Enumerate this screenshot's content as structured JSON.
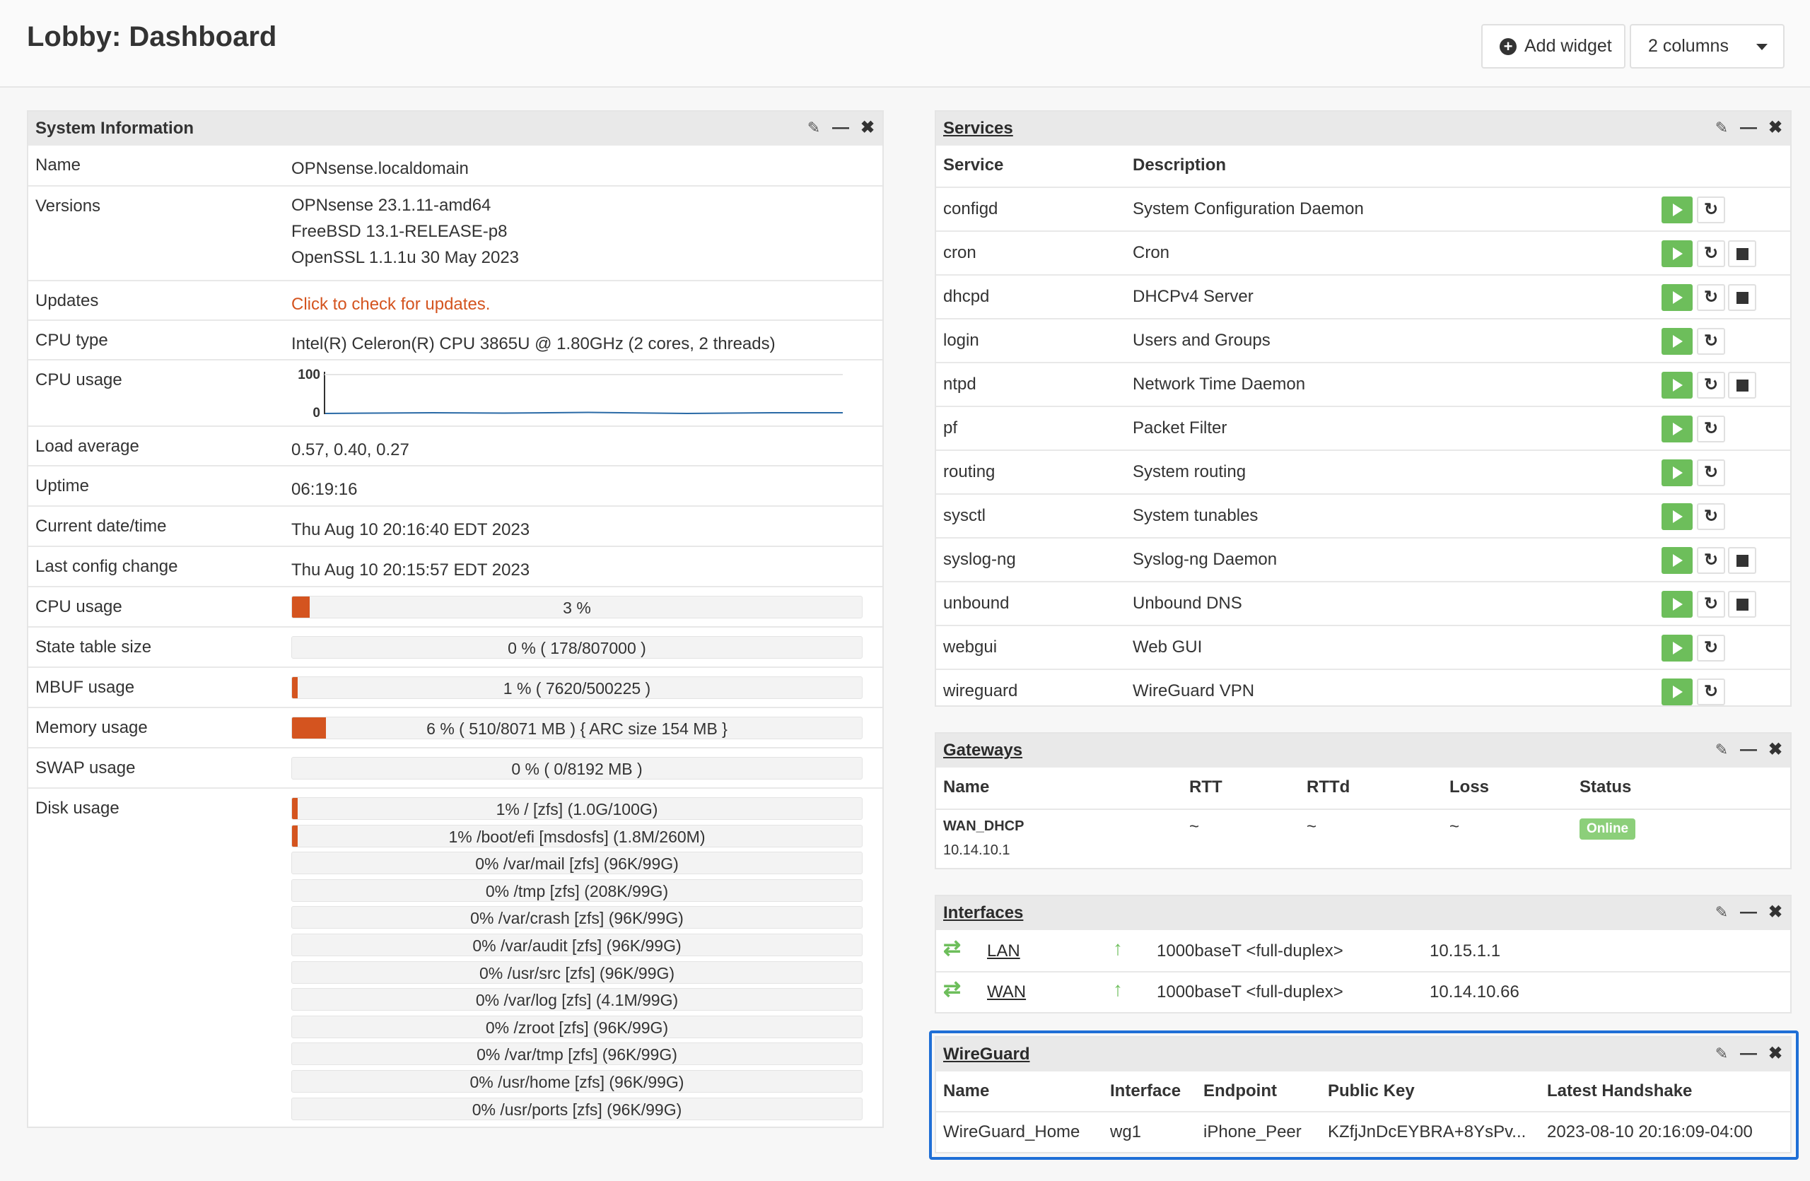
{
  "page": {
    "title": "Lobby: Dashboard"
  },
  "toolbar": {
    "add_widget_label": "Add widget",
    "columns_label": "2 columns"
  },
  "sysinfo": {
    "title": "System Information",
    "rows": {
      "name": {
        "label": "Name",
        "value": "OPNsense.localdomain"
      },
      "versions": {
        "label": "Versions",
        "lines": [
          "OPNsense 23.1.11-amd64",
          "FreeBSD 13.1-RELEASE-p8",
          "OpenSSL 1.1.1u 30 May 2023"
        ]
      },
      "updates": {
        "label": "Updates",
        "value": "Click to check for updates."
      },
      "cputype": {
        "label": "CPU type",
        "value": "Intel(R) Celeron(R) CPU 3865U @ 1.80GHz (2 cores, 2 threads)"
      },
      "cpuusage_graph": {
        "label": "CPU usage",
        "ymax": "100",
        "ymin": "0"
      },
      "loadavg": {
        "label": "Load average",
        "value": "0.57, 0.40, 0.27"
      },
      "uptime": {
        "label": "Uptime",
        "value": "06:19:16"
      },
      "datetime": {
        "label": "Current date/time",
        "value": "Thu Aug 10 20:16:40 EDT 2023"
      },
      "lastconfig": {
        "label": "Last config change",
        "value": "Thu Aug 10 20:15:57 EDT 2023"
      },
      "cpu_bar": {
        "label": "CPU usage",
        "text": "3 %",
        "percent": 3
      },
      "state_bar": {
        "label": "State table size",
        "text": "0 % ( 178/807000 )",
        "percent": 0
      },
      "mbuf_bar": {
        "label": "MBUF usage",
        "text": "1 % ( 7620/500225 )",
        "percent": 1
      },
      "mem_bar": {
        "label": "Memory usage",
        "text": "6 % ( 510/8071 MB ) { ARC size 154 MB }",
        "percent": 6
      },
      "swap_bar": {
        "label": "SWAP usage",
        "text": "0 % ( 0/8192 MB )",
        "percent": 0
      },
      "disk": {
        "label": "Disk usage",
        "items": [
          {
            "text": "1% / [zfs] (1.0G/100G)",
            "percent": 1
          },
          {
            "text": "1% /boot/efi [msdosfs] (1.8M/260M)",
            "percent": 1
          },
          {
            "text": "0% /var/mail [zfs] (96K/99G)",
            "percent": 0
          },
          {
            "text": "0% /tmp [zfs] (208K/99G)",
            "percent": 0
          },
          {
            "text": "0% /var/crash [zfs] (96K/99G)",
            "percent": 0
          },
          {
            "text": "0% /var/audit [zfs] (96K/99G)",
            "percent": 0
          },
          {
            "text": "0% /usr/src [zfs] (96K/99G)",
            "percent": 0
          },
          {
            "text": "0% /var/log [zfs] (4.1M/99G)",
            "percent": 0
          },
          {
            "text": "0% /zroot [zfs] (96K/99G)",
            "percent": 0
          },
          {
            "text": "0% /var/tmp [zfs] (96K/99G)",
            "percent": 0
          },
          {
            "text": "0% /usr/home [zfs] (96K/99G)",
            "percent": 0
          },
          {
            "text": "0% /usr/ports [zfs] (96K/99G)",
            "percent": 0
          }
        ]
      }
    }
  },
  "services": {
    "title": "Services",
    "col_service": "Service",
    "col_description": "Description",
    "rows": [
      {
        "name": "configd",
        "desc": "System Configuration Daemon",
        "stop": false
      },
      {
        "name": "cron",
        "desc": "Cron",
        "stop": true
      },
      {
        "name": "dhcpd",
        "desc": "DHCPv4 Server",
        "stop": true
      },
      {
        "name": "login",
        "desc": "Users and Groups",
        "stop": false
      },
      {
        "name": "ntpd",
        "desc": "Network Time Daemon",
        "stop": true
      },
      {
        "name": "pf",
        "desc": "Packet Filter",
        "stop": false
      },
      {
        "name": "routing",
        "desc": "System routing",
        "stop": false
      },
      {
        "name": "sysctl",
        "desc": "System tunables",
        "stop": false
      },
      {
        "name": "syslog-ng",
        "desc": "Syslog-ng Daemon",
        "stop": true
      },
      {
        "name": "unbound",
        "desc": "Unbound DNS",
        "stop": true
      },
      {
        "name": "webgui",
        "desc": "Web GUI",
        "stop": false
      },
      {
        "name": "wireguard",
        "desc": "WireGuard VPN",
        "stop": false
      }
    ]
  },
  "gateways": {
    "title": "Gateways",
    "cols": {
      "name": "Name",
      "rtt": "RTT",
      "rttd": "RTTd",
      "loss": "Loss",
      "status": "Status"
    },
    "row": {
      "name": "WAN_DHCP",
      "addr": "10.14.10.1",
      "rtt": "~",
      "rttd": "~",
      "loss": "~",
      "status": "Online"
    }
  },
  "interfaces": {
    "title": "Interfaces",
    "rows": [
      {
        "name": "LAN",
        "media": "1000baseT <full-duplex>",
        "ip": "10.15.1.1"
      },
      {
        "name": "WAN",
        "media": "1000baseT <full-duplex>",
        "ip": "10.14.10.66"
      }
    ]
  },
  "wireguard": {
    "title": "WireGuard",
    "cols": {
      "name": "Name",
      "interface": "Interface",
      "endpoint": "Endpoint",
      "pubkey": "Public Key",
      "handshake": "Latest Handshake"
    },
    "row": {
      "name": "WireGuard_Home",
      "interface": "wg1",
      "endpoint": "iPhone_Peer",
      "pubkey": "KZfjJnDcEYBRA+8YsPv...",
      "handshake": "2023-08-10 20:16:09-04:00"
    }
  },
  "colors": {
    "accent": "#d4541f",
    "green": "#6dbe5b",
    "online": "#8ccf7a",
    "highlight": "#1f6fd6"
  }
}
